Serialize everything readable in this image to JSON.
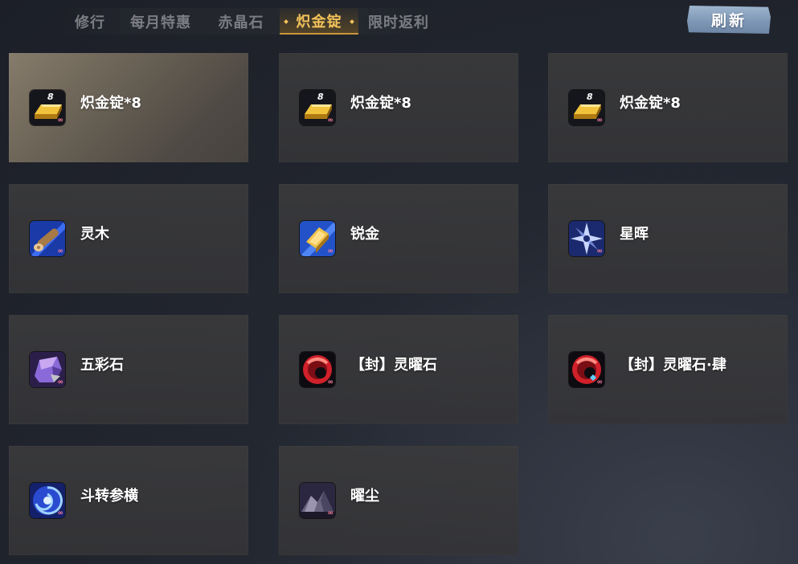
{
  "tabs": [
    {
      "label": "修行",
      "active": false
    },
    {
      "label": "每月特惠",
      "active": false
    },
    {
      "label": "赤晶石",
      "active": false
    },
    {
      "label": "炽金锭",
      "active": true
    },
    {
      "label": "限时返利",
      "active": false
    }
  ],
  "refresh_label": "刷新",
  "items": [
    {
      "name": "炽金锭*8",
      "icon": "gold-ingot-icon",
      "badge": "8",
      "selected": true
    },
    {
      "name": "炽金锭*8",
      "icon": "gold-ingot-icon",
      "badge": "8",
      "selected": false
    },
    {
      "name": "炽金锭*8",
      "icon": "gold-ingot-icon",
      "badge": "8",
      "selected": false
    },
    {
      "name": "灵木",
      "icon": "spirit-wood-icon",
      "selected": false
    },
    {
      "name": "锐金",
      "icon": "sharp-gold-icon",
      "selected": false
    },
    {
      "name": "星晖",
      "icon": "star-radiance-icon",
      "selected": false
    },
    {
      "name": "五彩石",
      "icon": "five-color-stone-icon",
      "selected": false
    },
    {
      "name": "【封】灵曜石",
      "icon": "sealed-spirit-stone-icon",
      "selected": false
    },
    {
      "name": "【封】灵曜石·肆",
      "icon": "sealed-spirit-stone-iv-icon",
      "selected": false
    },
    {
      "name": "斗转参横",
      "icon": "star-shift-swirl-icon",
      "selected": false
    },
    {
      "name": "曜尘",
      "icon": "radiant-dust-icon",
      "selected": false
    }
  ],
  "infinity_glyph": "∞",
  "colors": {
    "active_tab": "#f3c25a",
    "inactive_tab": "#7b7d83",
    "refresh_button": "#8aa2c0",
    "card": "#38383b",
    "selected_card": "#756c5f"
  }
}
